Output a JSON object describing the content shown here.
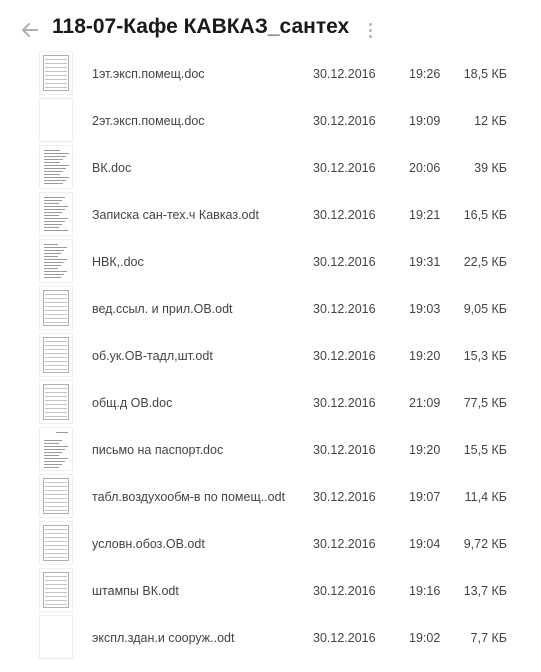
{
  "header": {
    "back_icon": "arrow-left-icon",
    "title": "118-07-Кафе КАВКАЗ_сантех",
    "menu_icon": "more-vertical-icon"
  },
  "files": [
    {
      "name": "1эт.эксп.помещ.doc",
      "date": "30.12.2016",
      "time": "19:26",
      "size": "18,5 КБ",
      "thumb": "table"
    },
    {
      "name": "2эт.эксп.помещ.doc",
      "date": "30.12.2016",
      "time": "19:09",
      "size": "12 КБ",
      "thumb": "blank"
    },
    {
      "name": "ВК.doc",
      "date": "30.12.2016",
      "time": "20:06",
      "size": "39 КБ",
      "thumb": "text"
    },
    {
      "name": "Записка сан-тех.ч Кавказ.odt",
      "date": "30.12.2016",
      "time": "19:21",
      "size": "16,5 КБ",
      "thumb": "text"
    },
    {
      "name": "НВК,.doc",
      "date": "30.12.2016",
      "time": "19:31",
      "size": "22,5 КБ",
      "thumb": "text"
    },
    {
      "name": "вед.ссыл. и прил.ОВ.odt",
      "date": "30.12.2016",
      "time": "19:03",
      "size": "9,05 КБ",
      "thumb": "table"
    },
    {
      "name": "об.ук.ОВ-тадл,шт.odt",
      "date": "30.12.2016",
      "time": "19:20",
      "size": "15,3 КБ",
      "thumb": "table"
    },
    {
      "name": "общ.д ОВ.doc",
      "date": "30.12.2016",
      "time": "21:09",
      "size": "77,5 КБ",
      "thumb": "table"
    },
    {
      "name": "письмо на паспорт.doc",
      "date": "30.12.2016",
      "time": "19:20",
      "size": "15,5 КБ",
      "thumb": "letter"
    },
    {
      "name": "табл.воздухообм-в по помещ..odt",
      "date": "30.12.2016",
      "time": "19:07",
      "size": "11,4 КБ",
      "thumb": "table"
    },
    {
      "name": "условн.обоз.ОВ.odt",
      "date": "30.12.2016",
      "time": "19:04",
      "size": "9,72 КБ",
      "thumb": "table"
    },
    {
      "name": "штампы ВК.odt",
      "date": "30.12.2016",
      "time": "19:16",
      "size": "13,7 КБ",
      "thumb": "table"
    },
    {
      "name": "экспл.здан.и сооруж..odt",
      "date": "30.12.2016",
      "time": "19:02",
      "size": "7,7 КБ",
      "thumb": "blank"
    }
  ]
}
